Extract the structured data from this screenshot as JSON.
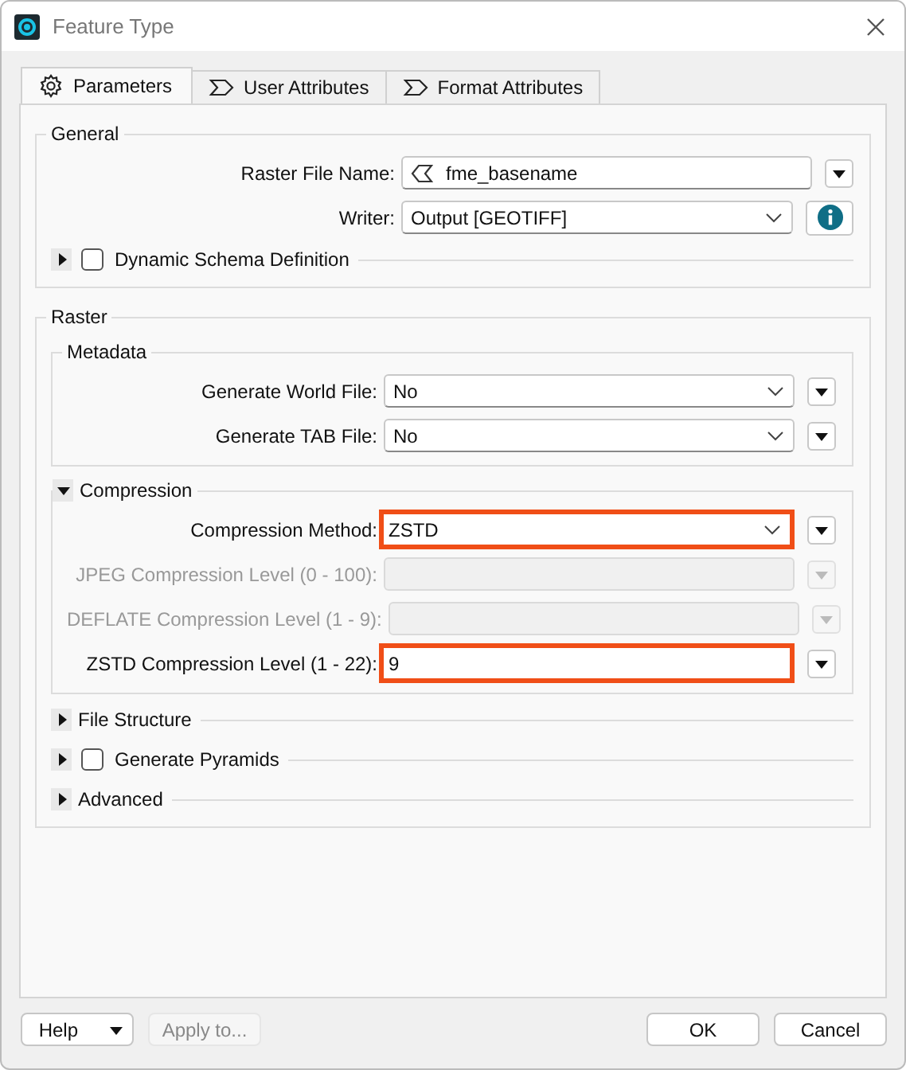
{
  "window": {
    "title": "Feature Type"
  },
  "tabs": [
    {
      "label": "Parameters",
      "selected": true
    },
    {
      "label": "User Attributes",
      "selected": false
    },
    {
      "label": "Format Attributes",
      "selected": false
    }
  ],
  "sections": [
    {
      "kind": "group",
      "title": "General",
      "items": [
        {
          "kind": "text_field",
          "label": "Raster File Name:",
          "value": "fme_basename",
          "side": {
            "kind": "menu"
          },
          "disabled": false,
          "highlighted": false
        },
        {
          "kind": "dropdown",
          "label": "Writer:",
          "value": "Output [GEOTIFF]",
          "side": {
            "kind": "info"
          },
          "disabled": false,
          "highlighted": false
        },
        {
          "kind": "collapsible",
          "label": "Dynamic Schema Definition",
          "expanded": false,
          "checked": false
        }
      ]
    },
    {
      "kind": "group",
      "title": "Raster",
      "items": [
        {
          "kind": "group",
          "title": "Metadata",
          "items": [
            {
              "kind": "dropdown",
              "label": "Generate World File:",
              "value": "No",
              "side": {
                "kind": "menu"
              },
              "disabled": false,
              "highlighted": false
            },
            {
              "kind": "dropdown",
              "label": "Generate TAB File:",
              "value": "No",
              "side": {
                "kind": "menu"
              },
              "disabled": false,
              "highlighted": false
            }
          ]
        },
        {
          "kind": "collapsible",
          "label": "Compression",
          "expanded": true,
          "items": [
            {
              "kind": "dropdown",
              "label": "Compression Method:",
              "value": "ZSTD",
              "side": {
                "kind": "menu"
              },
              "disabled": false,
              "highlighted": true
            },
            {
              "kind": "input_field",
              "label": "JPEG Compression Level (0 - 100):",
              "side": {
                "kind": "menu"
              },
              "disabled": true,
              "highlighted": false
            },
            {
              "kind": "input_field",
              "label": "DEFLATE Compression Level (1 - 9):",
              "side": {
                "kind": "menu"
              },
              "disabled": true,
              "highlighted": false
            },
            {
              "kind": "input_field",
              "label": "ZSTD Compression Level (1 - 22):",
              "value": "9",
              "side": {
                "kind": "menu"
              },
              "disabled": false,
              "highlighted": true
            }
          ]
        },
        {
          "kind": "collapsible",
          "label": "File Structure",
          "expanded": false
        },
        {
          "kind": "collapsible",
          "label": "Generate Pyramids",
          "expanded": false,
          "checked": false
        },
        {
          "kind": "collapsible",
          "label": "Advanced",
          "expanded": false
        }
      ]
    }
  ],
  "footer": {
    "left": [
      {
        "label": "Help",
        "kind": "split",
        "disabled": false
      },
      {
        "label": "Apply to...",
        "kind": "plain",
        "disabled": true
      }
    ],
    "right": [
      {
        "label": "OK",
        "kind": "plain",
        "disabled": false
      },
      {
        "label": "Cancel",
        "kind": "plain",
        "disabled": false
      }
    ]
  }
}
